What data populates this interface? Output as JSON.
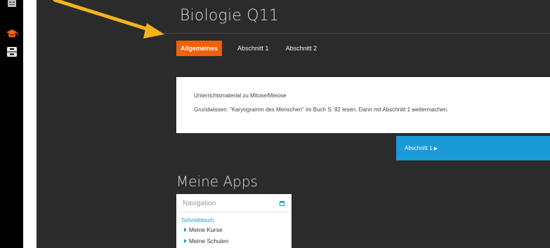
{
  "course": {
    "title": "Biologie Q11"
  },
  "tabs": [
    {
      "label": "Allgemeines",
      "active": true
    },
    {
      "label": "Abschnitt 1",
      "active": false
    },
    {
      "label": "Abschnitt 2",
      "active": false
    }
  ],
  "info": {
    "line1": "Unterrichtsmaterial zu Mitose/Meiose",
    "line2": "Grundwissen: \"Karyogramm des Menschen\" im Buch S. 82 lesen. Dann mit Abschnitt 1 weitermachen."
  },
  "next_button": {
    "label": "Abschnitt 1",
    "arrow": "▶"
  },
  "apps": {
    "heading": "Meine Apps"
  },
  "navigation": {
    "title": "Navigation",
    "root": "Schreibtisch",
    "items": [
      "Meine Kurse",
      "Meine Schulen"
    ]
  },
  "icons": {
    "rail_top": "grid-icon",
    "rail_courses": "graduation-cap-icon",
    "rail_storage": "filing-cabinet-icon",
    "nav_dock": "dock-block-icon",
    "overlay": "pointer-arrow-icon"
  },
  "colors": {
    "accent_orange": "#f0610b",
    "accent_blue": "#1a9bd7",
    "background_dark": "#2b2b2b",
    "rail_black": "#000000",
    "pointer_yellow": "#f5b41c"
  }
}
